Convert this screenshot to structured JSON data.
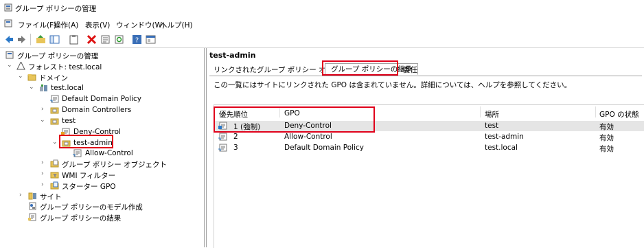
{
  "window": {
    "title": "グループ ポリシーの管理"
  },
  "menu": [
    "ファイル(F)",
    "操作(A)",
    "表示(V)",
    "ウィンドウ(W)",
    "ヘルプ(H)"
  ],
  "tree": {
    "root": "グループ ポリシーの管理",
    "forest": "フォレスト: test.local",
    "domains": "ドメイン",
    "domain": "test.local",
    "default_policy": "Default Domain Policy",
    "domain_controllers": "Domain Controllers",
    "test_ou": "test",
    "deny_control": "Deny-Control",
    "test_admin": "test-admin",
    "allow_control": "Allow-Control",
    "gpo_objects": "グループ ポリシー オブジェクト",
    "wmi_filters": "WMI フィルター",
    "starter_gpo": "スターター GPO",
    "sites": "サイト",
    "modeling": "グループ ポリシーのモデル作成",
    "results": "グループ ポリシーの結果"
  },
  "detail": {
    "title": "test-admin",
    "tabs": [
      "リンクされたグループ ポリシー オブジェクト",
      "グループ ポリシーの継承",
      "委任"
    ],
    "active_tab_index": 1,
    "note": "この一覧にはサイトにリンクされた GPO は含まれていません。詳細については、ヘルプを参照してください。",
    "columns": [
      "優先順位",
      "GPO",
      "場所",
      "GPO の状態"
    ],
    "rows": [
      {
        "order": "1 (強制)",
        "gpo": "Deny-Control",
        "location": "test",
        "status": "有効"
      },
      {
        "order": "2",
        "gpo": "Allow-Control",
        "location": "test-admin",
        "status": "有効"
      },
      {
        "order": "3",
        "gpo": "Default Domain Policy",
        "location": "test.local",
        "status": "有効"
      }
    ]
  },
  "colors": {
    "highlight": "#e0001a",
    "selected_row": "#e5e5e5",
    "folder": "#e8c55a"
  }
}
